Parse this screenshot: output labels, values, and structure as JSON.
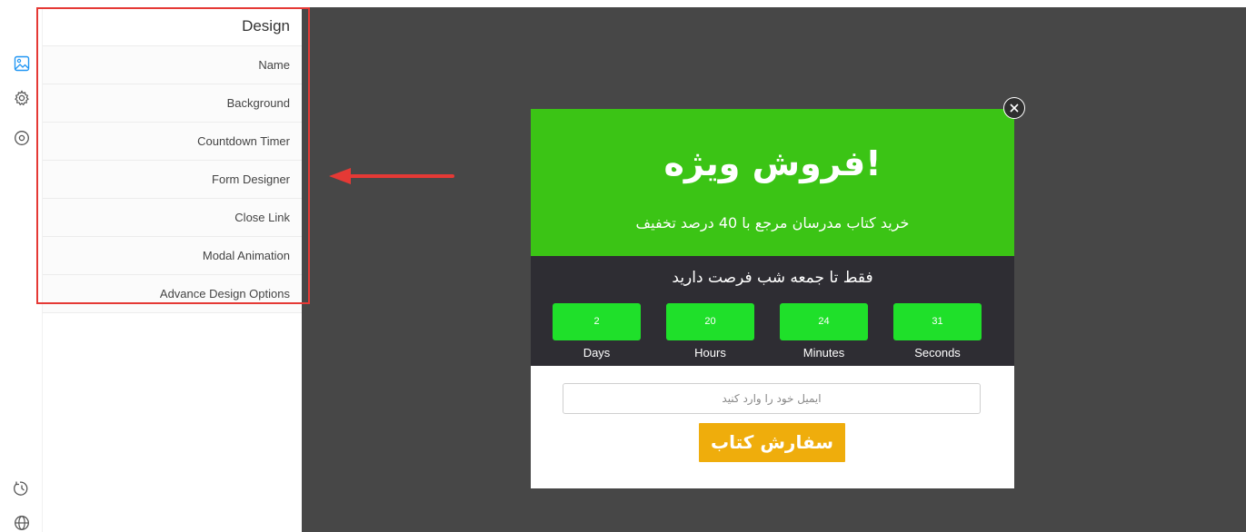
{
  "rail": {
    "icons": [
      "image-icon",
      "gear-icon",
      "target-icon",
      "history-icon",
      "globe-icon"
    ]
  },
  "panel": {
    "title": "Design",
    "items": [
      {
        "label": "Name"
      },
      {
        "label": "Background"
      },
      {
        "label": "Countdown Timer"
      },
      {
        "label": "Form Designer"
      },
      {
        "label": "Close Link"
      },
      {
        "label": "Modal Animation"
      },
      {
        "label": "Advance Design Options"
      }
    ]
  },
  "colors": {
    "annotation": "#e53935",
    "canvas_bg": "#474747",
    "hero_green": "#3bc415",
    "timer_bg": "#2e2d33",
    "timer_box": "#1fe02a",
    "order_button": "#efad0c"
  },
  "popup": {
    "title": "!فروش ویژه",
    "subtitle": "خرید کتاب مدرسان مرجع با 40 درصد تخفیف",
    "timer_title": "فقط تا جمعه شب فرصت دارید",
    "countdown": [
      {
        "value": "2",
        "label": "Days"
      },
      {
        "value": "20",
        "label": "Hours"
      },
      {
        "value": "24",
        "label": "Minutes"
      },
      {
        "value": "31",
        "label": "Seconds"
      }
    ],
    "email_placeholder": "ایمیل خود را وارد کنید",
    "order_button": "سفارش کتاب"
  }
}
